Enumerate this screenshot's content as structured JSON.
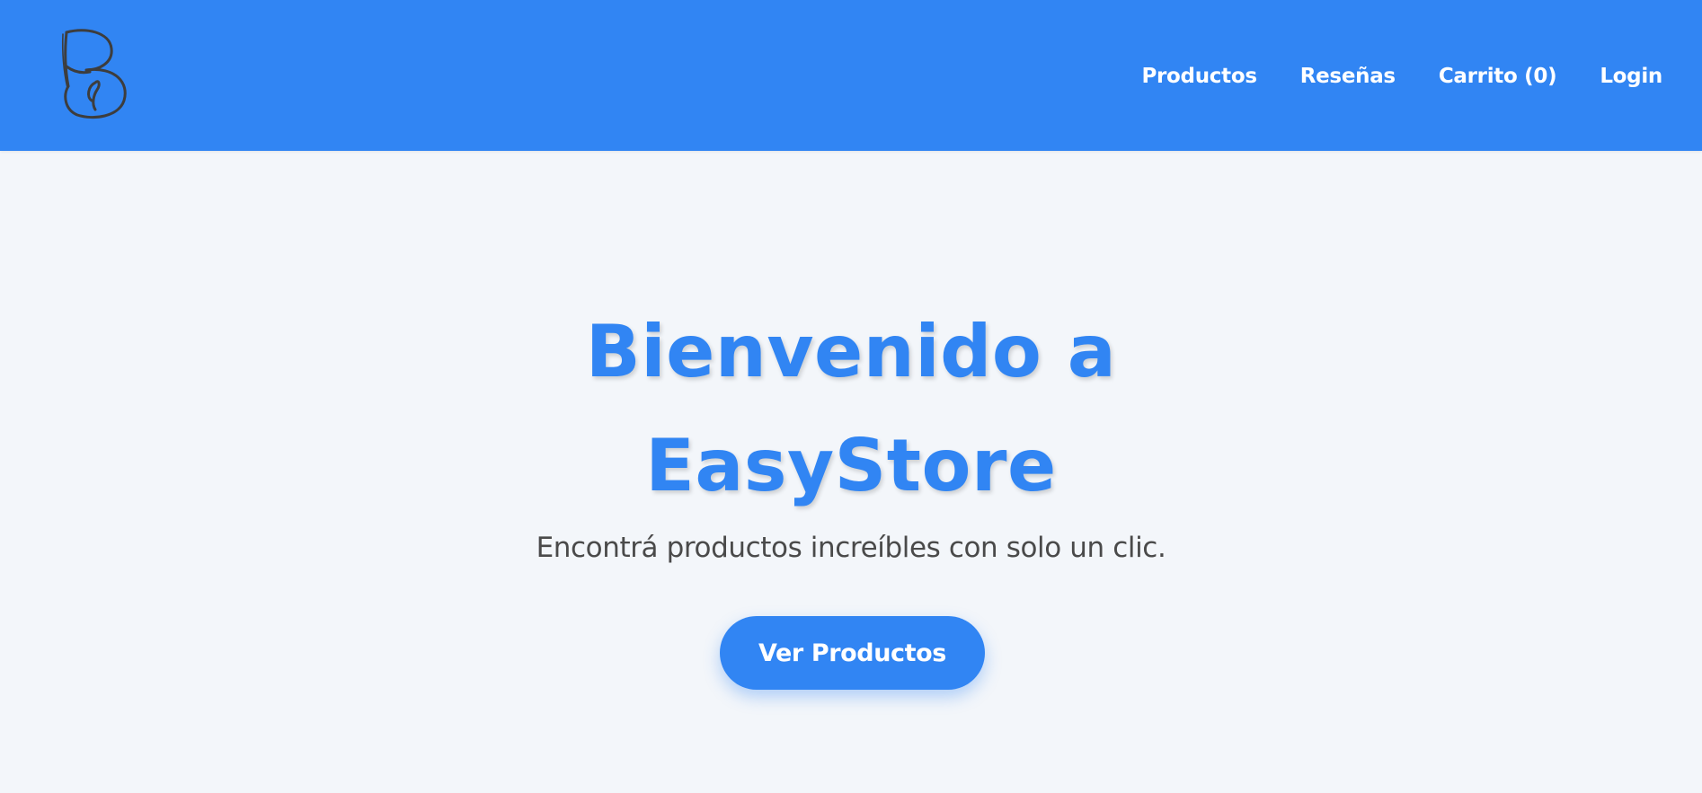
{
  "header": {
    "background_color": "#3185f3",
    "logo_icon": "easystore-logo",
    "nav": {
      "items": [
        {
          "label": "Productos"
        },
        {
          "label": "Reseñas"
        },
        {
          "label": "Carrito (0)"
        },
        {
          "label": "Login"
        }
      ]
    }
  },
  "hero": {
    "title_line1": "Bienvenido a",
    "title_line2": "EasyStore",
    "subtitle": "Encontrá productos increíbles con solo un clic.",
    "cta_label": "Ver Productos",
    "accent_color": "#3185f3"
  }
}
